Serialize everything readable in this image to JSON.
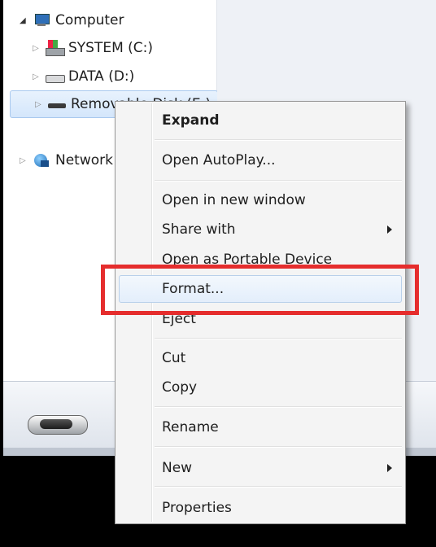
{
  "tree": {
    "computer": "Computer",
    "system": "SYSTEM (C:)",
    "data": "DATA (D:)",
    "removable": "Removable Disk (E:)",
    "network": "Network"
  },
  "details": {
    "text": ""
  },
  "menu": {
    "expand": "Expand",
    "autoplay": "Open AutoPlay...",
    "new_window": "Open in new window",
    "share_with": "Share with",
    "portable_device": "Open as Portable Device",
    "format": "Format...",
    "eject": "Eject",
    "cut": "Cut",
    "copy": "Copy",
    "rename": "Rename",
    "new": "New",
    "properties": "Properties"
  },
  "colors": {
    "highlight": "#e52d2d",
    "selection": "#d4e6fb"
  }
}
